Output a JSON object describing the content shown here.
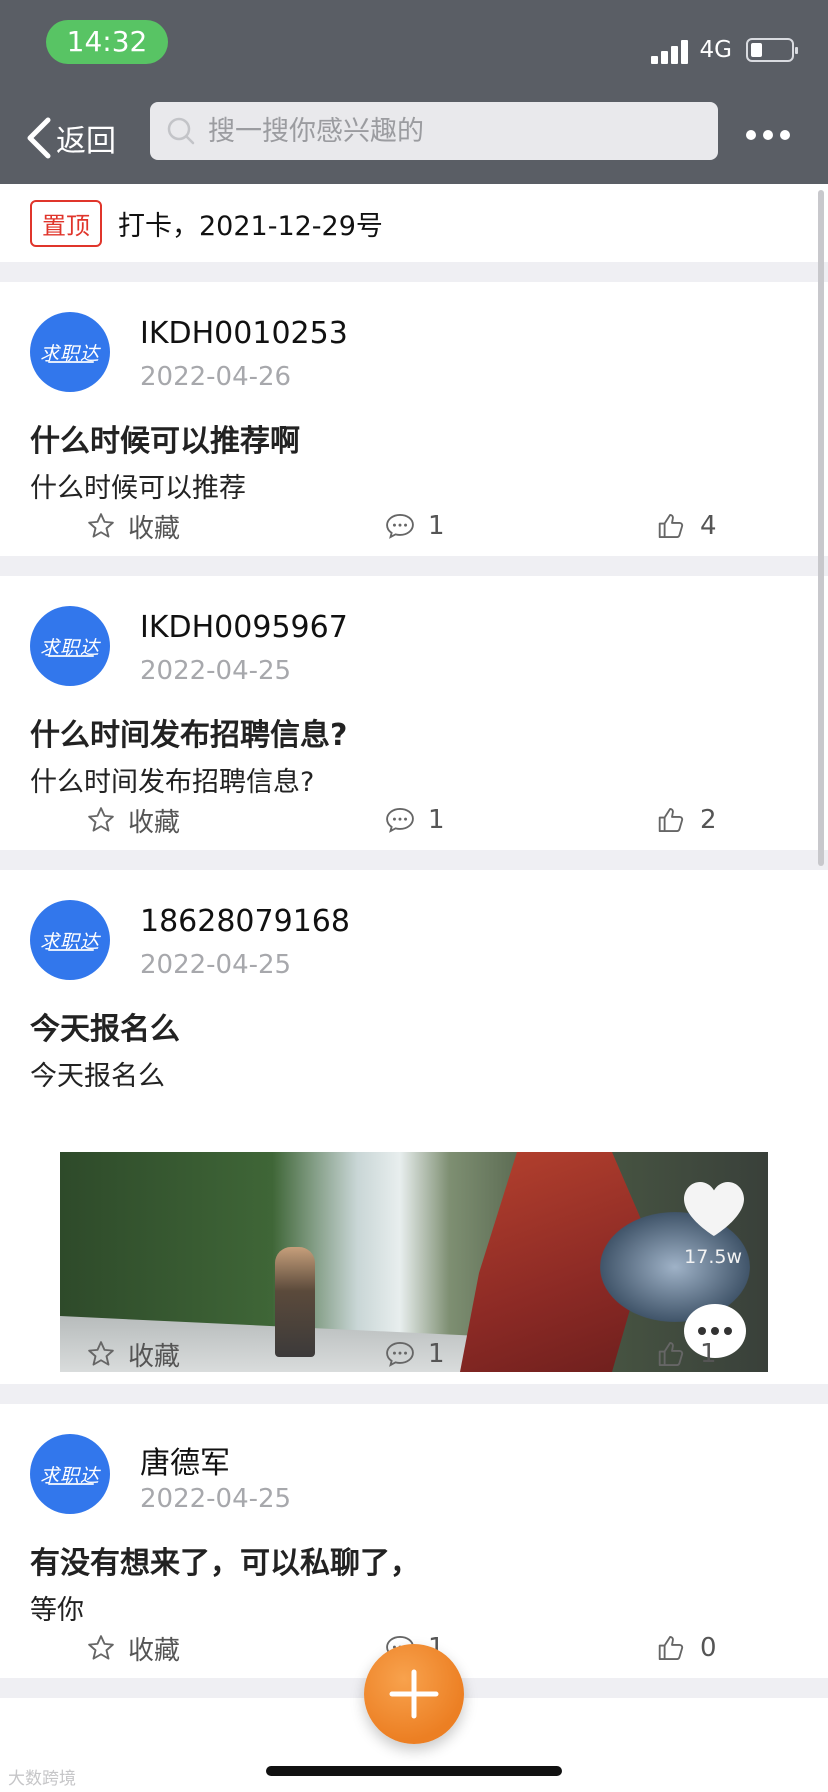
{
  "status_bar": {
    "time": "14:32",
    "network": "4G",
    "battery_percent": 30
  },
  "nav": {
    "back_label": "返回",
    "search_placeholder": "搜一搜你感兴趣的"
  },
  "pinned": {
    "tag": "置顶",
    "text": "打卡，2021-12-29号"
  },
  "avatar_text": "求职达",
  "actions": {
    "favorite_label": "收藏"
  },
  "posts": [
    {
      "author": "IKDH0010253",
      "date": "2022-04-26",
      "title": "什么时候可以推荐啊",
      "body": "什么时候可以推荐",
      "comments": "1",
      "likes": "4"
    },
    {
      "author": "IKDH0095967",
      "date": "2022-04-25",
      "title": "什么时间发布招聘信息?",
      "body": "什么时间发布招聘信息?",
      "comments": "1",
      "likes": "2"
    },
    {
      "author": "18628079168",
      "date": "2022-04-25",
      "title": "今天报名么",
      "body": "今天报名么",
      "comments": "1",
      "likes": "1",
      "video": {
        "like_count": "17.5w"
      }
    },
    {
      "author": "唐德军",
      "date": "2022-04-25",
      "title": "有没有想来了，可以私聊了，",
      "body": "等你",
      "comments": "1",
      "likes": "0"
    }
  ],
  "watermark": "大数跨境",
  "colors": {
    "header": "#5a5e65",
    "time_pill": "#58c464",
    "avatar": "#3277ec",
    "pin_red": "#e0352b",
    "fab": "#ec7f23"
  }
}
